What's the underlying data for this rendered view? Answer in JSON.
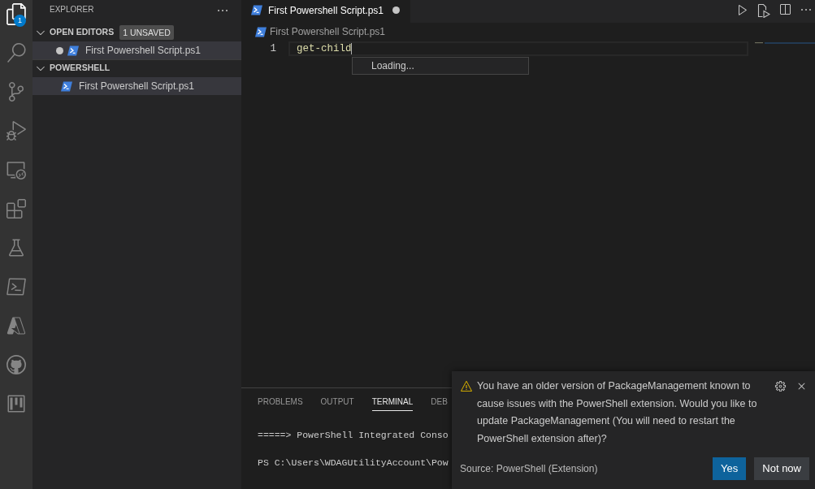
{
  "activity_bar": {
    "items": [
      {
        "kind": "explorer",
        "selected": true,
        "badge": "1"
      },
      {
        "kind": "search",
        "selected": false
      },
      {
        "kind": "source_control",
        "selected": false
      },
      {
        "kind": "run_debug",
        "selected": false
      },
      {
        "kind": "remote",
        "selected": false
      },
      {
        "kind": "extensions",
        "selected": false
      },
      {
        "kind": "testing",
        "selected": false
      },
      {
        "kind": "powershell",
        "selected": false
      },
      {
        "kind": "azure",
        "selected": false
      },
      {
        "kind": "github",
        "selected": false
      },
      {
        "kind": "project",
        "selected": false
      }
    ]
  },
  "sidebar": {
    "title": "EXPLORER",
    "sections": [
      {
        "title": "OPEN EDITORS",
        "expanded": true,
        "badge": "1 UNSAVED",
        "items": [
          {
            "label": "First Powershell Script.ps1",
            "dirty": true,
            "selected": true
          }
        ]
      },
      {
        "title": "POWERSHELL",
        "expanded": true,
        "items": [
          {
            "label": "First Powershell Script.ps1",
            "selected": true
          }
        ]
      }
    ]
  },
  "editor": {
    "tabs": [
      {
        "label": "First Powershell Script.ps1",
        "selected": true,
        "dirty": true
      }
    ],
    "breadcrumb": "First Powershell Script.ps1",
    "lines": [
      {
        "number": "1",
        "code": "get-child",
        "current": true
      }
    ],
    "suggest_widget": {
      "message": "Loading..."
    }
  },
  "panel": {
    "tabs": [
      {
        "label": "PROBLEMS",
        "selected": false
      },
      {
        "label": "OUTPUT",
        "selected": false
      },
      {
        "label": "TERMINAL",
        "selected": true
      },
      {
        "label": "DEB",
        "selected": false
      }
    ],
    "terminal_lines": [
      "=====> PowerShell Integrated Conso",
      "PS C:\\Users\\WDAGUtilityAccount\\Pow"
    ]
  },
  "notification": {
    "message": "You have an older version of PackageManagement known to cause issues with the PowerShell extension. Would you like to update PackageManagement (You will need to restart the PowerShell extension after)?",
    "source": "Source: PowerShell (Extension)",
    "buttons": [
      {
        "label": "Yes",
        "kind": "primary"
      },
      {
        "label": "Not now",
        "kind": "secondary"
      }
    ]
  }
}
